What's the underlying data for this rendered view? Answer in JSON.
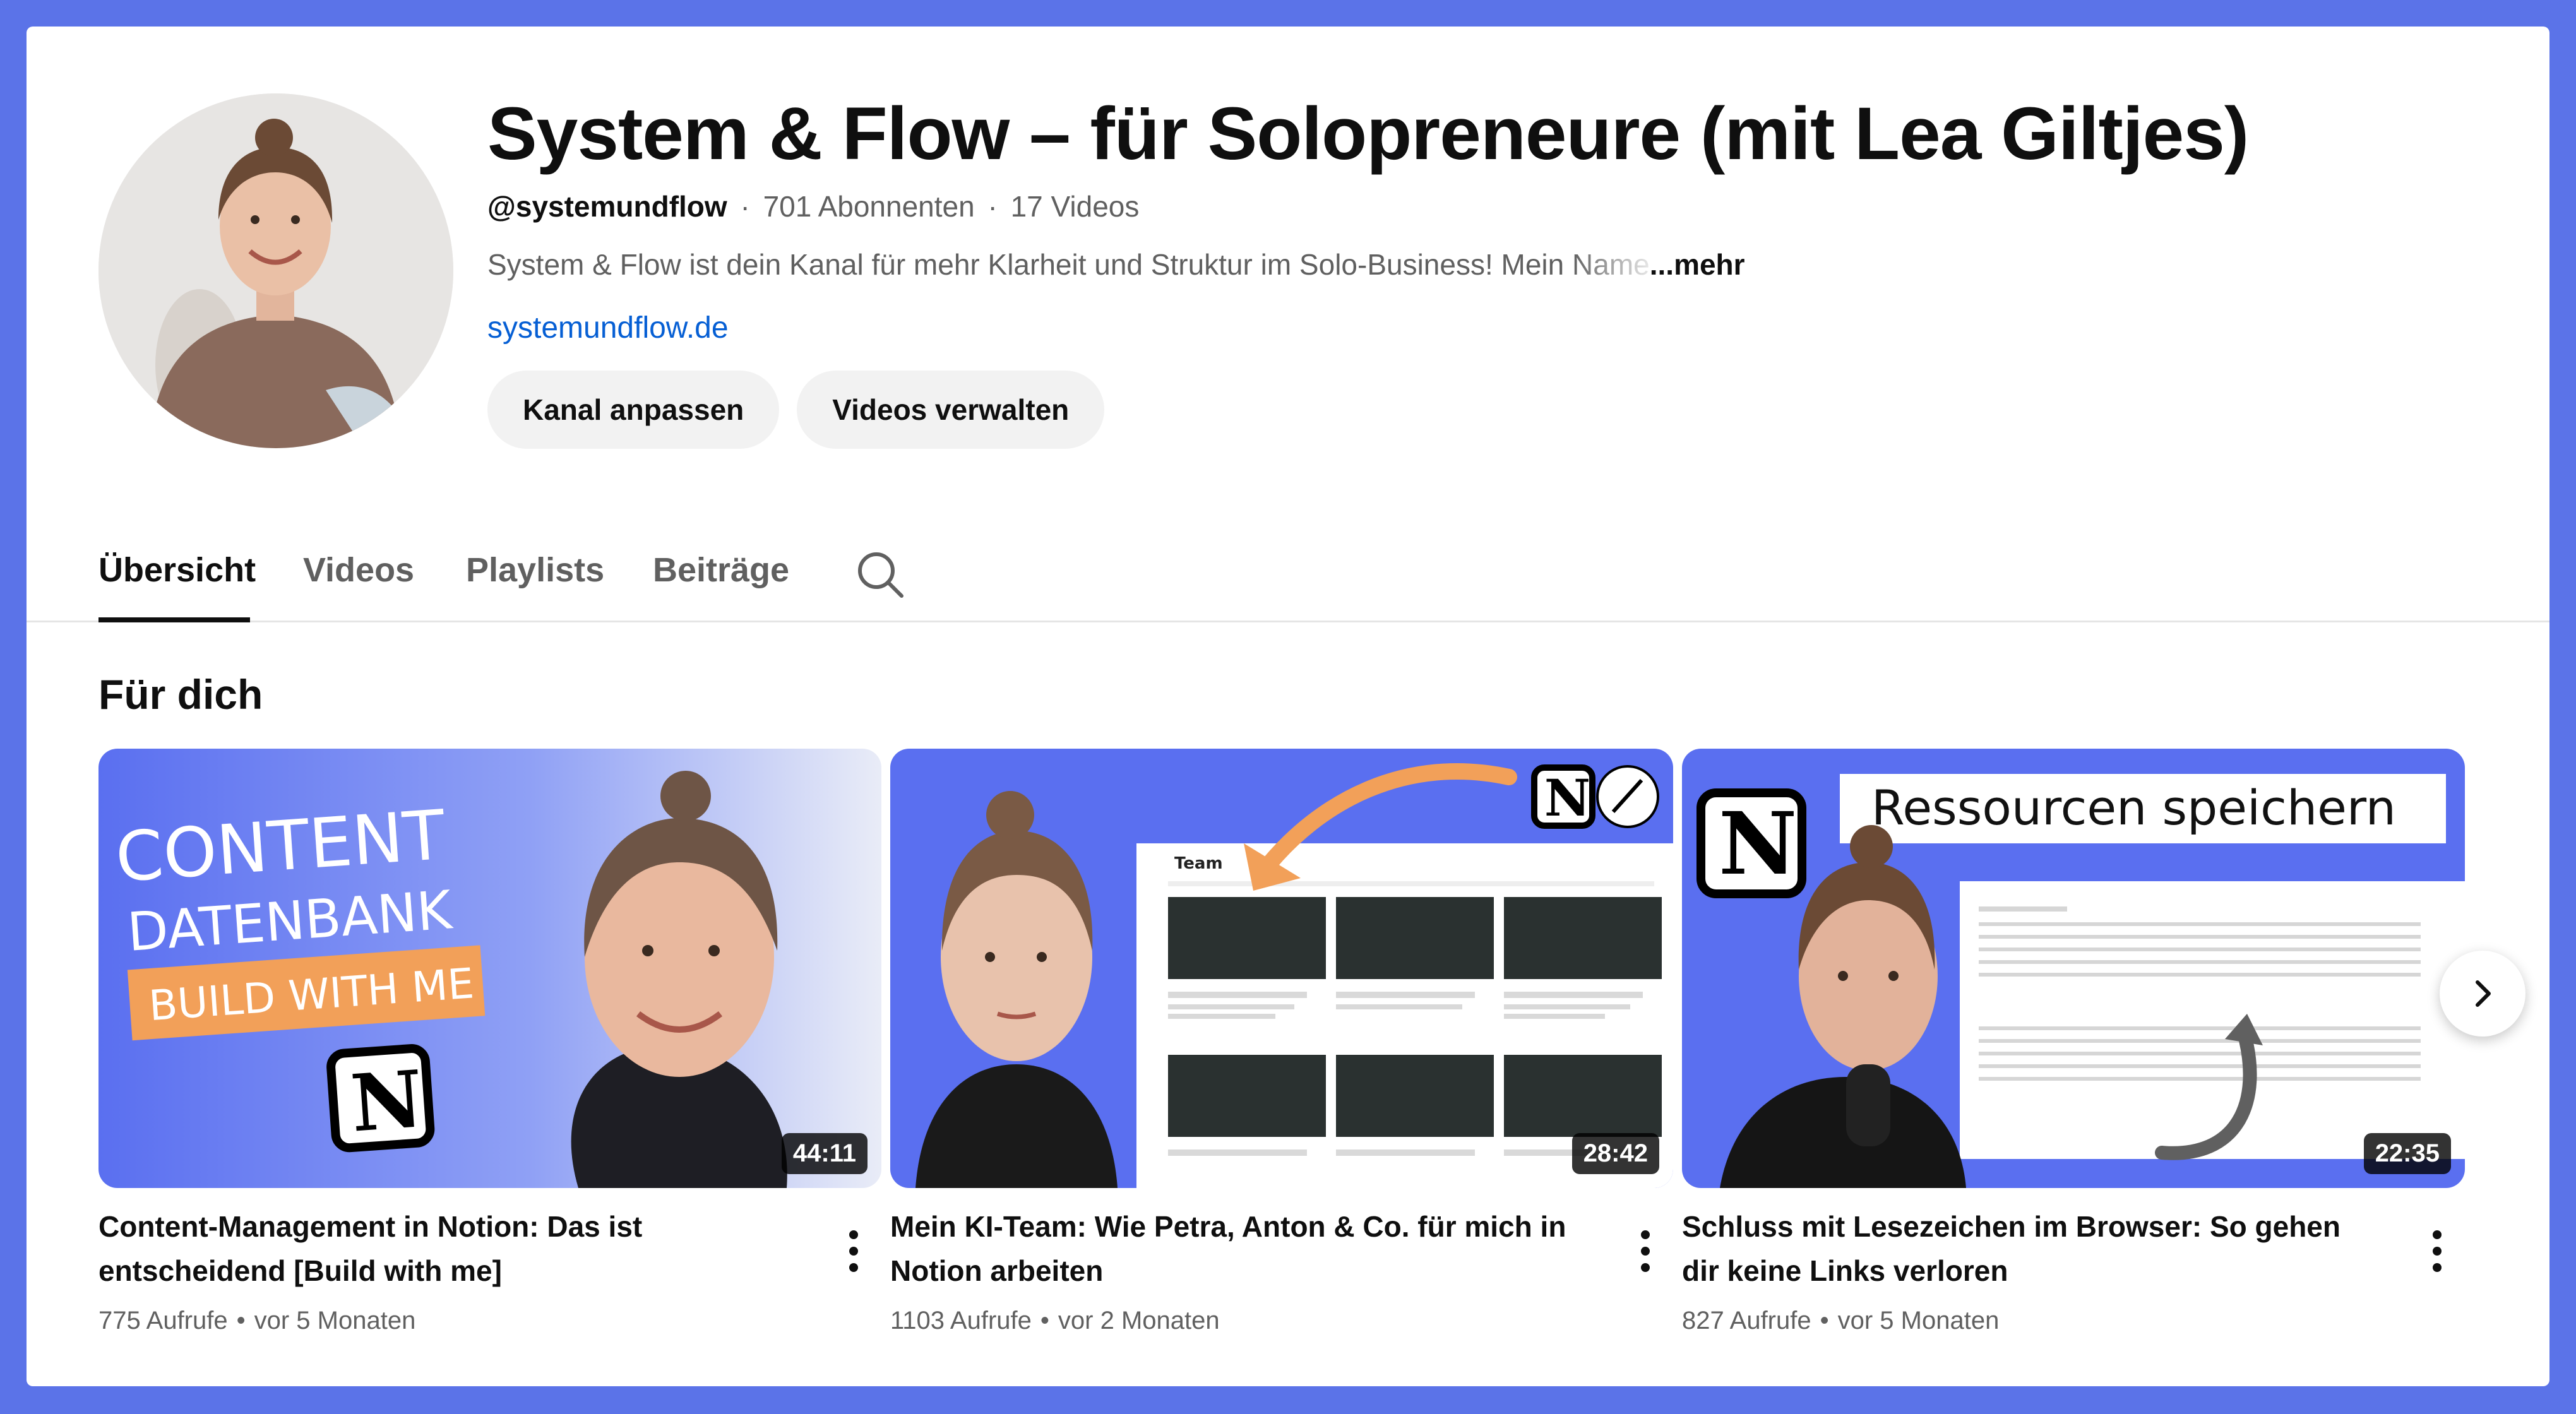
{
  "channel": {
    "title": "System & Flow – für Solopreneure (mit Lea Giltjes)",
    "handle": "@systemundflow",
    "subscribers": "701 Abonnenten",
    "videos_count": "17 Videos",
    "description": "System & Flow ist dein Kanal für mehr Klarheit und Struktur im Solo-Business! Mein ",
    "description_fade": "Name",
    "more_label": "...mehr",
    "link": "systemundflow.de",
    "customize_label": "Kanal anpassen",
    "manage_label": "Videos verwalten"
  },
  "tabs": [
    {
      "label": "Übersicht",
      "active": true
    },
    {
      "label": "Videos"
    },
    {
      "label": "Playlists"
    },
    {
      "label": "Beiträge"
    }
  ],
  "section": {
    "title": "Für dich"
  },
  "videos": [
    {
      "title": "Content-Management in Notion: Das ist entscheidend [Build with me]",
      "duration": "44:11",
      "views": "775 Aufrufe",
      "age": "vor 5 Monaten",
      "thumb_text": [
        "CONTENT",
        "DATENBANK",
        "BUILD WITH ME"
      ]
    },
    {
      "title": "Mein KI-Team: Wie Petra, Anton & Co. für mich in Notion arbeiten",
      "duration": "28:42",
      "views": "1103 Aufrufe",
      "age": "vor 2 Monaten",
      "thumb_text": [
        "Team"
      ]
    },
    {
      "title": "Schluss mit Lesezeichen im Browser: So gehen dir keine Links verloren",
      "duration": "22:35",
      "views": "827 Aufrufe",
      "age": "vor 5 Monaten",
      "thumb_text": [
        "Ressourcen speichern"
      ]
    }
  ],
  "colors": {
    "background": "#5b73e8",
    "link": "#065fd4",
    "thumb_blue": "#5a6ff0",
    "accent_orange": "#f2a059"
  }
}
